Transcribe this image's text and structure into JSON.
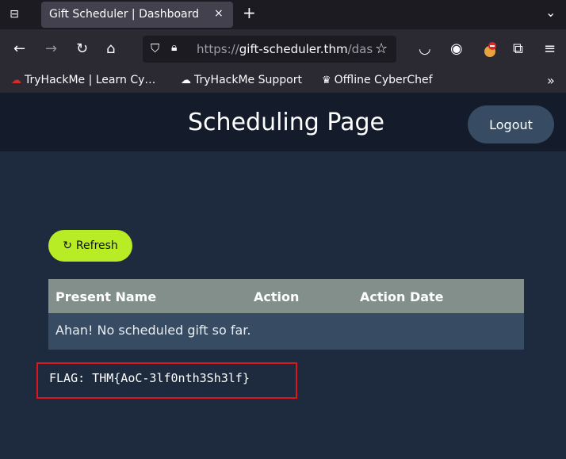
{
  "browser": {
    "tab_title": "Gift Scheduler | Dashboard",
    "tab_close": "×",
    "new_tab": "+",
    "url_scheme": "https://",
    "url_host": "gift-scheduler.thm",
    "url_rest": "/dashboard",
    "bookmarks": [
      {
        "label": "TryHackMe | Learn Cy…",
        "icon": "tryhackme-icon"
      },
      {
        "label": "TryHackMe Support",
        "icon": "support-icon"
      },
      {
        "label": "Offline CyberChef",
        "icon": "cyberchef-icon"
      }
    ]
  },
  "page": {
    "title": "Scheduling Page",
    "logout_label": "Logout",
    "refresh_label": "Refresh",
    "table": {
      "headers": [
        "Present Name",
        "Action",
        "Action Date"
      ],
      "empty_message": "Ahan! No scheduled gift so far."
    },
    "flag": "FLAG: THM{AoC-3lf0nth3Sh3lf}"
  },
  "colors": {
    "header_bg": "#141c2b",
    "page_bg": "#1e2a3d",
    "refresh_accent": "#b8ec25",
    "table_header": "#838f8a",
    "table_row": "#374c63",
    "flag_border": "#e0141c"
  }
}
